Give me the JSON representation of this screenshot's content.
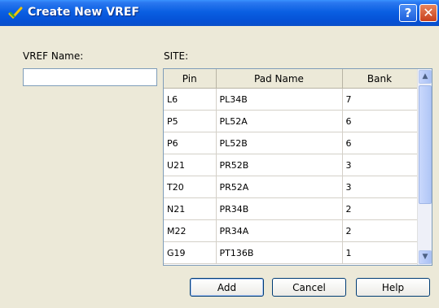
{
  "window": {
    "title": "Create New VREF"
  },
  "titlebar": {
    "help_glyph": "?",
    "close_glyph": "✕"
  },
  "form": {
    "name_label": "VREF Name:",
    "name_value": "",
    "site_label": "SITE:"
  },
  "site_table": {
    "columns": [
      "Pin",
      "Pad Name",
      "Bank"
    ],
    "rows": [
      [
        "L6",
        "PL34B",
        "7"
      ],
      [
        "P5",
        "PL52A",
        "6"
      ],
      [
        "P6",
        "PL52B",
        "6"
      ],
      [
        "U21",
        "PR52B",
        "3"
      ],
      [
        "T20",
        "PR52A",
        "3"
      ],
      [
        "N21",
        "PR34B",
        "2"
      ],
      [
        "M22",
        "PR34A",
        "2"
      ],
      [
        "G19",
        "PT136B",
        "1"
      ]
    ]
  },
  "buttons": {
    "add": "Add",
    "cancel": "Cancel",
    "help": "Help"
  },
  "scrollbar": {
    "up_glyph": "▲",
    "down_glyph": "▼"
  },
  "colors": {
    "title_bar": "#0a5fe2",
    "close_button": "#c8401c",
    "dialog_background": "#ece9d8"
  },
  "icons": {
    "title": "checkmark-pencil-icon"
  }
}
